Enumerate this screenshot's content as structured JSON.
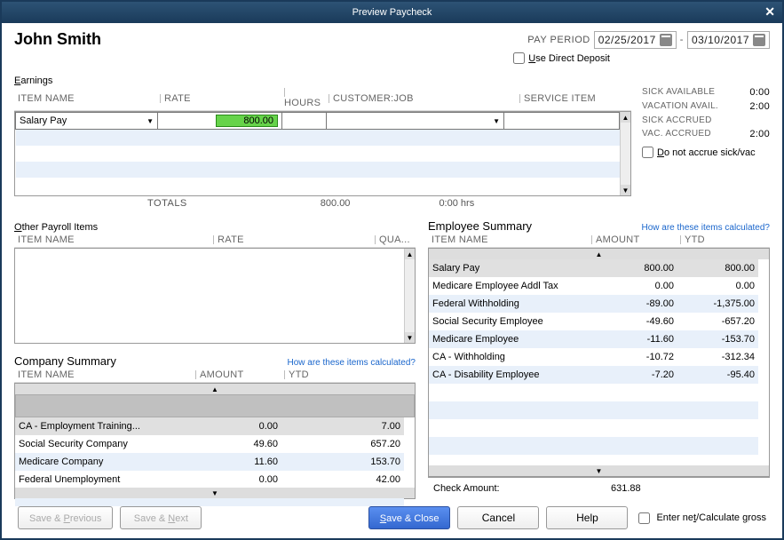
{
  "window": {
    "title": "Preview Paycheck"
  },
  "employee": {
    "name": "John Smith"
  },
  "period": {
    "label": "PAY PERIOD",
    "start": "02/25/2017",
    "sep": "-",
    "end": "03/10/2017"
  },
  "direct_deposit": {
    "label_u": "U",
    "label_rest": "se Direct Deposit",
    "checked": false
  },
  "earnings": {
    "title_u": "E",
    "title_rest": "arnings",
    "columns": {
      "item_name": "ITEM NAME",
      "rate": "RATE",
      "hours": "HOURS",
      "customer_job": "CUSTOMER:JOB",
      "service_item": "SERVICE ITEM"
    },
    "rows": [
      {
        "item_name": "Salary Pay",
        "rate": "800.00",
        "hours": "",
        "customer_job": "",
        "service_item": ""
      }
    ],
    "totals": {
      "label": "TOTALS",
      "rate": "800.00",
      "hours": "0:00",
      "hours_suffix": "hrs"
    }
  },
  "pto": {
    "rows": [
      {
        "label": "SICK AVAILABLE",
        "value": "0:00"
      },
      {
        "label": "VACATION AVAIL.",
        "value": "2:00"
      },
      {
        "label": "SICK ACCRUED",
        "value": ""
      },
      {
        "label": "VAC. ACCRUED",
        "value": "2:00"
      }
    ],
    "accrue_u": "D",
    "accrue_rest": "o not accrue sick/vac"
  },
  "other_items": {
    "title_u": "O",
    "title_rest": "ther Payroll Items",
    "columns": {
      "item_name": "ITEM NAME",
      "rate": "RATE",
      "qua": "QUA..."
    }
  },
  "company_summary": {
    "title": "Company Summary",
    "link": "How are these items calculated?",
    "columns": {
      "item_name": "ITEM NAME",
      "amount": "AMOUNT",
      "ytd": "YTD"
    },
    "rows": [
      {
        "item_name": "CA - Employment Training...",
        "amount": "0.00",
        "ytd": "7.00"
      },
      {
        "item_name": "Social Security Company",
        "amount": "49.60",
        "ytd": "657.20"
      },
      {
        "item_name": "Medicare Company",
        "amount": "11.60",
        "ytd": "153.70"
      },
      {
        "item_name": "Federal Unemployment",
        "amount": "0.00",
        "ytd": "42.00"
      }
    ]
  },
  "employee_summary": {
    "title": "Employee Summary",
    "link": "How are these items calculated?",
    "columns": {
      "item_name": "ITEM NAME",
      "amount": "AMOUNT",
      "ytd": "YTD"
    },
    "rows": [
      {
        "item_name": "Salary Pay",
        "amount": "800.00",
        "ytd": "800.00"
      },
      {
        "item_name": "Medicare Employee Addl Tax",
        "amount": "0.00",
        "ytd": "0.00"
      },
      {
        "item_name": "Federal Withholding",
        "amount": "-89.00",
        "ytd": "-1,375.00"
      },
      {
        "item_name": "Social Security Employee",
        "amount": "-49.60",
        "ytd": "-657.20"
      },
      {
        "item_name": "Medicare Employee",
        "amount": "-11.60",
        "ytd": "-153.70"
      },
      {
        "item_name": "CA - Withholding",
        "amount": "-10.72",
        "ytd": "-312.34"
      },
      {
        "item_name": "CA - Disability Employee",
        "amount": "-7.20",
        "ytd": "-95.40"
      }
    ],
    "check_label": "Check Amount:",
    "check_amount": "631.88"
  },
  "footer": {
    "save_previous_u": "P",
    "save_previous_pre": "Save & ",
    "save_previous_rest": "revious",
    "save_next_u": "N",
    "save_next_pre": "Save & ",
    "save_next_rest": "ext",
    "save_close_u": "S",
    "save_close_rest": "ave & Close",
    "cancel": "Cancel",
    "help": "Help",
    "calcgross_pre": "Enter ne",
    "calcgross_u": "t",
    "calcgross_mid": "/Calculate ",
    "calcgross_u2": "g",
    "calcgross_rest": "ross"
  }
}
